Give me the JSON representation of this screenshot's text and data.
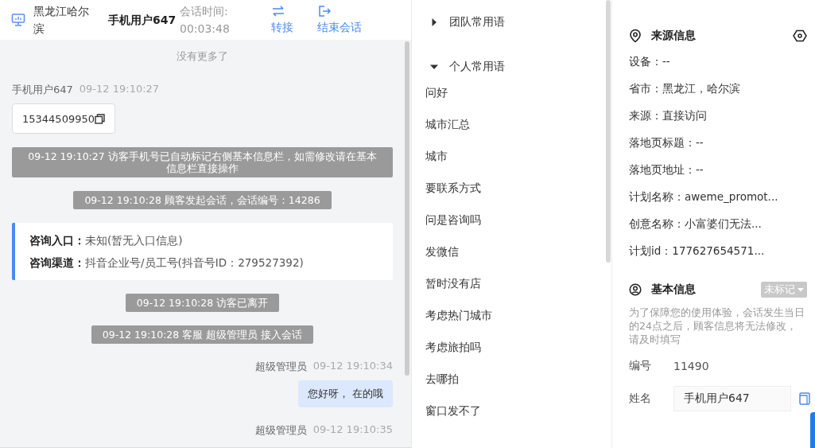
{
  "header": {
    "location": "黑龙江哈尔滨",
    "user": "手机用户647",
    "session_label": "会话时间:",
    "session_time": "00:03:48",
    "actions": [
      {
        "kind": "transfer",
        "label": "转接"
      },
      {
        "kind": "end",
        "label": "结束会话"
      }
    ]
  },
  "messages": [
    {
      "kind": "divider",
      "text": "没有更多了"
    },
    {
      "kind": "visitor",
      "name": "手机用户647",
      "time": "09-12 19:10:27",
      "text": "15344509950"
    },
    {
      "kind": "system",
      "text": "09-12 19:10:27 访客手机号已自动标记右侧基本信息栏，如需修改请在基本信息栏直接操作"
    },
    {
      "kind": "system",
      "text": "09-12 19:10:28 顾客发起会话，会话编号：14286"
    },
    {
      "kind": "info",
      "lines": [
        {
          "label": "咨询入口：",
          "value": "未知(暂无入口信息)"
        },
        {
          "label": "咨询渠道：",
          "value": "抖音企业号/员工号(抖音号ID：279527392)"
        }
      ]
    },
    {
      "kind": "system",
      "text": "09-12 19:10:28 访客已离开"
    },
    {
      "kind": "system",
      "text": "09-12 19:10:28 客服 超级管理员 接入会话"
    },
    {
      "kind": "agent",
      "name": "超级管理员",
      "time": "09-12 19:10:34",
      "text": "您好呀， 在的哦"
    },
    {
      "kind": "agent",
      "name": "超级管理员",
      "time": "09-12 19:10:35"
    }
  ],
  "phrases": [
    {
      "title": "团队常用语",
      "expanded": false
    },
    {
      "title": "个人常用语",
      "expanded": true,
      "items": [
        "问好",
        "城市汇总",
        "城市",
        "要联系方式",
        "问是咨询吗",
        "发微信",
        "暂时没有店",
        "考虑热门城市",
        "考虑旅拍吗",
        "去哪拍",
        "窗口发不了"
      ]
    }
  ],
  "source_info": {
    "title": "来源信息",
    "fields": [
      "设备：--",
      "省市：黑龙江，哈尔滨",
      "来源：直接访问",
      "落地页标题：--",
      "落地页地址：--",
      "计划名称：aweme_promot...",
      "创意名称：小富婆们无法...",
      "计划id：177627654571..."
    ]
  },
  "basic_info": {
    "title": "基本信息",
    "tag": "未标记",
    "notice": "为了保障您的使用体验，会话发生当日的24点之后，顾客信息将无法修改，请及时填写",
    "fields": [
      {
        "kind": "text",
        "label": "编号",
        "value": "11490"
      },
      {
        "kind": "input",
        "label": "姓名",
        "value": "手机用户647"
      }
    ]
  }
}
